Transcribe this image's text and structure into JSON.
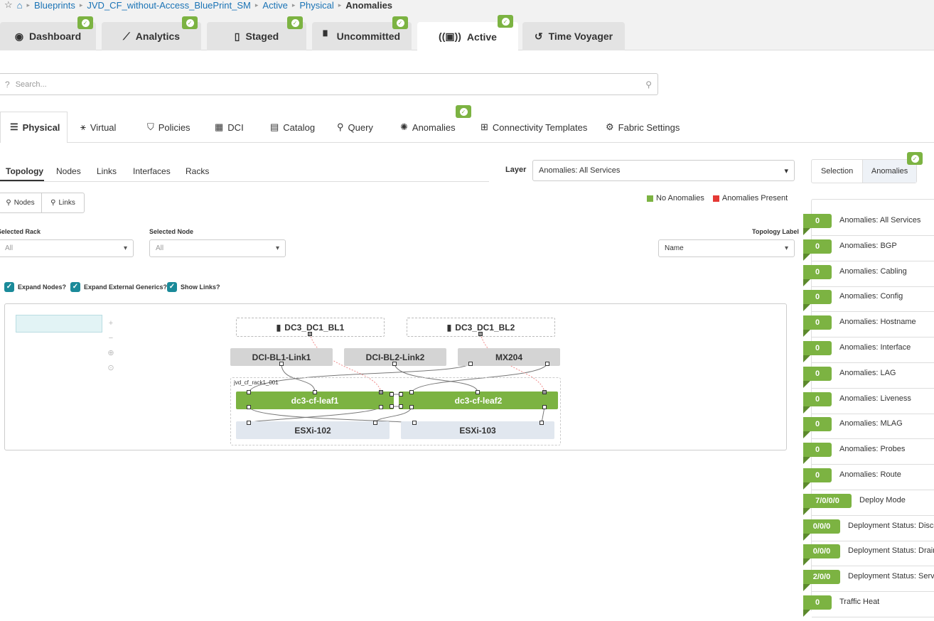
{
  "breadcrumb": [
    "Blueprints",
    "JVD_CF_without-Access_BluePrint_SM",
    "Active",
    "Physical",
    "Anomalies"
  ],
  "top_tabs": [
    {
      "label": "Dashboard",
      "icon": "dashboard-icon"
    },
    {
      "label": "Analytics",
      "icon": "chart-icon"
    },
    {
      "label": "Staged",
      "icon": "staged-icon"
    },
    {
      "label": "Uncommitted",
      "icon": "uncommitted-icon"
    },
    {
      "label": "Active",
      "icon": "active-icon"
    },
    {
      "label": "Time Voyager",
      "icon": "history-icon"
    }
  ],
  "search": {
    "placeholder": "Search..."
  },
  "nav_tabs": [
    "Physical",
    "Virtual",
    "Policies",
    "DCI",
    "Catalog",
    "Query",
    "Anomalies",
    "Connectivity Templates",
    "Fabric Settings"
  ],
  "sub_tabs": [
    "Topology",
    "Nodes",
    "Links",
    "Interfaces",
    "Racks"
  ],
  "layer": {
    "label": "Layer",
    "value": "Anomalies: All Services"
  },
  "filter_buttons": [
    "Nodes",
    "Links"
  ],
  "legend": {
    "ok": "No Anomalies",
    "bad": "Anomalies Present",
    "ok_color": "#7cb342",
    "bad_color": "#e53935"
  },
  "filters": {
    "rack_label": "Selected Rack",
    "rack_value": "All",
    "node_label": "Selected Node",
    "node_value": "All",
    "topo_label": "Topology Label",
    "topo_value": "Name"
  },
  "checkboxes": [
    "Expand Nodes?",
    "Expand External Generics?",
    "Show Links?"
  ],
  "topology": {
    "externals": [
      "DC3_DC1_BL1",
      "DC3_DC1_BL2"
    ],
    "generics": [
      "DCI-BL1-Link1",
      "DCI-BL2-Link2",
      "MX204"
    ],
    "rack": "jvd_cf_rack1_001",
    "leafs": [
      "dc3-cf-leaf1",
      "dc3-cf-leaf2"
    ],
    "servers": [
      "ESXi-102",
      "ESXi-103"
    ]
  },
  "right_panel": {
    "toggle": [
      "Selection",
      "Anomalies"
    ],
    "rows": [
      {
        "count": "0",
        "label": "Anomalies: All Services"
      },
      {
        "count": "0",
        "label": "Anomalies: BGP"
      },
      {
        "count": "0",
        "label": "Anomalies: Cabling"
      },
      {
        "count": "0",
        "label": "Anomalies: Config"
      },
      {
        "count": "0",
        "label": "Anomalies: Hostname"
      },
      {
        "count": "0",
        "label": "Anomalies: Interface"
      },
      {
        "count": "0",
        "label": "Anomalies: LAG"
      },
      {
        "count": "0",
        "label": "Anomalies: Liveness"
      },
      {
        "count": "0",
        "label": "Anomalies: MLAG"
      },
      {
        "count": "0",
        "label": "Anomalies: Probes"
      },
      {
        "count": "0",
        "label": "Anomalies: Route"
      },
      {
        "count": "7/0/0/0",
        "label": "Deploy Mode"
      },
      {
        "count": "0/0/0",
        "label": "Deployment Status: Discovery"
      },
      {
        "count": "0/0/0",
        "label": "Deployment Status: Drain"
      },
      {
        "count": "2/0/0",
        "label": "Deployment Status: Service"
      },
      {
        "count": "0",
        "label": "Traffic Heat"
      }
    ]
  }
}
